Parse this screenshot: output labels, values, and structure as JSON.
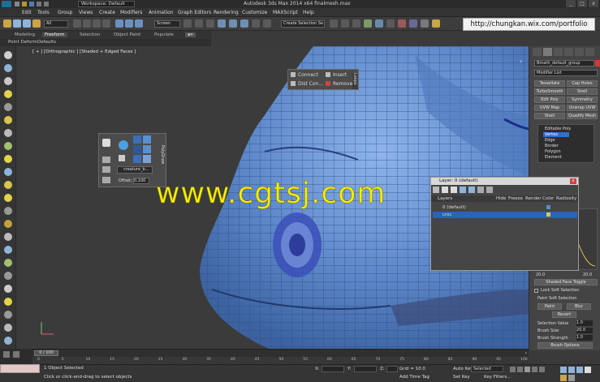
{
  "title_bar": {
    "workspace": "Workspace: Default",
    "title": "Autodesk 3ds Max 2014 x64     finalmesh.max",
    "window_buttons": [
      "_",
      "□",
      "x"
    ]
  },
  "menu": [
    "Edit",
    "Tools",
    "Group",
    "Views",
    "Create",
    "Modifiers",
    "Animation",
    "Graph Editors",
    "Rendering",
    "Customize",
    "MAXScript",
    "Help"
  ],
  "toolbar": {
    "selection_filter": "All",
    "coord_system": "Screen",
    "selection_set": "Create Selection Se"
  },
  "url_overlay": "http://chungkan.wix.com/portfolio",
  "ribbon": {
    "tabs": [
      "Modeling",
      "Freeform",
      "Selection",
      "Object Paint",
      "Populate"
    ],
    "active_tab": "Freeform",
    "sub_items": [
      "Point Deform",
      "Defaults"
    ]
  },
  "viewport": {
    "label": "[ + ] [Orthographic ] [Shaded + Edged Faces ]"
  },
  "connect_panel": {
    "items": [
      "Connect",
      "Insert",
      "Dist Con...",
      "Remove"
    ],
    "side_label": "Loops"
  },
  "polydraw_panel": {
    "object_label": "creature_b...",
    "offset_label": "Offset:",
    "offset_value": "0.100",
    "side_label": "PolyDraw"
  },
  "watermark": "www.cgtsj.com",
  "command_panel": {
    "object_name": "Bmath_default_group",
    "modifier_list": "Modifier List",
    "buttons": [
      "Tessellate",
      "Cap Holes",
      "TurboSmooth",
      "Shell",
      "Edit Poly",
      "Symmetry",
      "UVW Map",
      "Unwrap UVW",
      "Shell",
      "Quadify Mesh"
    ],
    "stack": [
      "Editable Poly",
      "Vertex",
      "Edge",
      "Border",
      "Polygon",
      "Element"
    ],
    "selected_stack_item": "Vertex",
    "values": [
      "20.0",
      "20.0"
    ],
    "shaded_toggle": "Shaded Face Toggle",
    "lock_soft": "Lock Soft Selection",
    "paint_soft": "Paint Soft Selection",
    "paint": "Paint",
    "blur": "Blur",
    "revert": "Revert",
    "selection_value": "Selection Value",
    "brush_size": "Brush Size",
    "brush_strength": "Brush Strength",
    "brush_options": "Brush Options",
    "sel_val_num": "1.0",
    "brush_size_num": "20.0",
    "brush_strength_num": "1.0"
  },
  "layer_window": {
    "title": "Layer: 0 (default)",
    "columns": [
      "Layers",
      "Hide",
      "Freeze",
      "Render",
      "Color",
      "Radiosity"
    ],
    "rows": [
      {
        "name": "0 (default)",
        "selected": false
      },
      {
        "name": "croc",
        "selected": true
      }
    ]
  },
  "timeline": {
    "frame": "0 / 100",
    "ticks": [
      "0",
      "5",
      "10",
      "15",
      "20",
      "25",
      "30",
      "35",
      "40",
      "45",
      "50",
      "55",
      "60",
      "65",
      "70",
      "75",
      "80",
      "85",
      "90",
      "95",
      "100"
    ]
  },
  "status": {
    "selected": "1 Object Selected",
    "prompt": "Click or click-and-drag to select objects",
    "x_label": "X:",
    "y_label": "Y:",
    "z_label": "Z:",
    "grid": "Grid = 10.0",
    "auto_key": "Auto Key",
    "set_key": "Set Key",
    "key_filters": "Key Filters...",
    "selected_dropdown": "Selected",
    "add_time_tag": "Add Time Tag"
  },
  "colors": {
    "mesh_blue": "#5b86c8",
    "selected_blue": "#2f6fd0",
    "watermark": "#f6f000",
    "background": "#3a3a3a"
  }
}
